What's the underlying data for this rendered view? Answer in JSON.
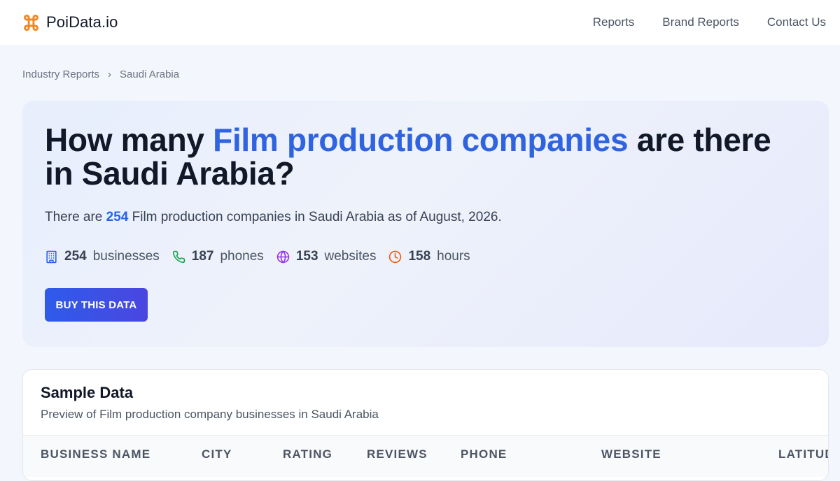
{
  "header": {
    "brand": "PoiData.io",
    "brand_icon": "command-key-icon",
    "brand_color": "#f08a24",
    "nav": [
      "Reports",
      "Brand Reports",
      "Contact Us"
    ]
  },
  "breadcrumb": {
    "items": [
      "Industry Reports",
      "Saudi Arabia"
    ],
    "separator": "›"
  },
  "hero": {
    "title_prefix": "How many ",
    "title_accent": "Film production companies",
    "title_suffix": " are there in Saudi Arabia?",
    "subtitle_prefix": "There are ",
    "subtitle_count": "254",
    "subtitle_suffix": " Film production companies in Saudi Arabia as of August, 2026.",
    "stats": [
      {
        "icon": "building-icon",
        "value": "254",
        "label": "businesses",
        "color": "#2563eb"
      },
      {
        "icon": "phone-icon",
        "value": "187",
        "label": "phones",
        "color": "#16a34a"
      },
      {
        "icon": "globe-icon",
        "value": "153",
        "label": "websites",
        "color": "#9333ea"
      },
      {
        "icon": "clock-icon",
        "value": "158",
        "label": "hours",
        "color": "#ea580c"
      }
    ],
    "button": "BUY THIS DATA",
    "accent_color": "#2f63e0"
  },
  "sample": {
    "title": "Sample Data",
    "description": "Preview of Film production company businesses in Saudi Arabia",
    "columns": [
      "BUSINESS NAME",
      "CITY",
      "RATING",
      "REVIEWS",
      "PHONE",
      "WEBSITE",
      "LATITUDE"
    ]
  }
}
